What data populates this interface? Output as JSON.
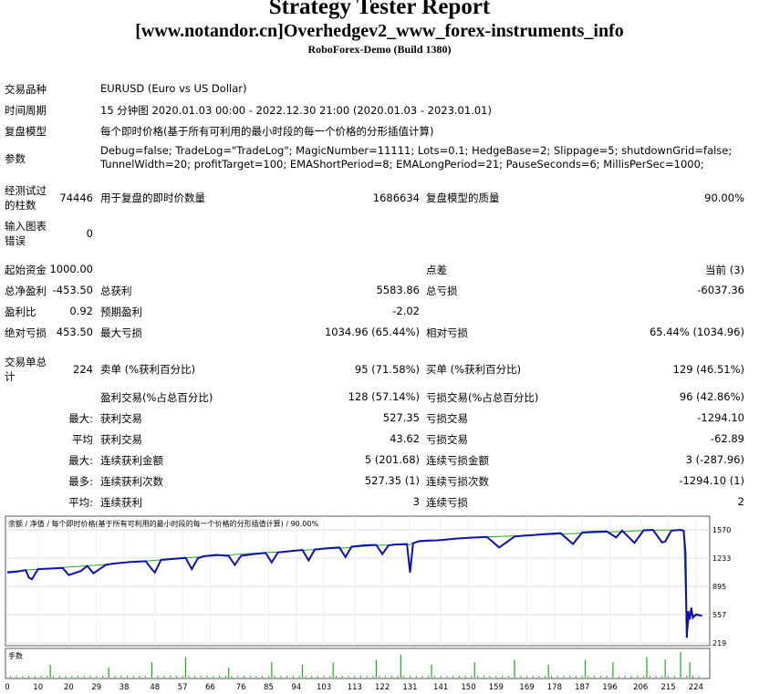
{
  "header": {
    "title": "Strategy Tester Report",
    "subtitle": "[www.notandor.cn]Overhedgev2_www_forex-instruments_info",
    "broker": "RoboForex-Demo (Build 1380)"
  },
  "info": {
    "symbol_label": "交易品种",
    "symbol_value": "EURUSD (Euro vs US Dollar)",
    "period_label": "时间周期",
    "period_value": "15 分钟图 2020.01.03 00:00 - 2022.12.30 21:00 (2020.01.03 - 2023.01.01)",
    "model_label": "复盘模型",
    "model_value": "每个即时价格(基于所有可利用的最小时段的每一个价格的分形插值计算)",
    "params_label": "参数",
    "params_line1": "Debug=false; TradeLog=\"TradeLog\"; MagicNumber=11111; Lots=0.1; HedgeBase=2; Slippage=5; shutdownGrid=false;",
    "params_line2": "TunnelWidth=20; profitTarget=100; EMAShortPeriod=8; EMALongPeriod=21; PauseSeconds=6; MillisPerSec=1000;"
  },
  "stats": {
    "bars_label1": "经测试过",
    "bars_label2": "的柱数",
    "bars_value": "74446",
    "ticks_label": "用于复盘的即时价数量",
    "ticks_value": "1686634",
    "quality_label": "复盘模型的质量",
    "quality_value": "90.00%",
    "errors_label1": "输入图表",
    "errors_label2": "错误",
    "errors_value": "0",
    "deposit_label": "起始资金",
    "deposit_value": "1000.00",
    "spread_label": "点差",
    "spread_value": "当前 (3)",
    "net_label": "总净盈利",
    "net_value": "-453.50",
    "gross_profit_label": "总获利",
    "gross_profit_value": "5583.86",
    "gross_loss_label": "总亏损",
    "gross_loss_value": "-6037.36",
    "pf_label": "盈利比",
    "pf_value": "0.92",
    "payoff_label": "预期盈利",
    "payoff_value": "-2.02",
    "abs_dd_label": "绝对亏损",
    "abs_dd_value": "453.50",
    "max_dd_label": "最大亏损",
    "max_dd_value": "1034.96 (65.44%)",
    "rel_dd_label": "相对亏损",
    "rel_dd_value": "65.44% (1034.96)",
    "trades_label1": "交易单总",
    "trades_label2": "计",
    "trades_value": "224",
    "short_label": "卖单 (%获利百分比)",
    "short_value": "95 (71.58%)",
    "long_label": "买单 (%获利百分比)",
    "long_value": "129 (46.51%)",
    "win_label": "盈利交易(%占总百分比)",
    "win_value": "128 (57.14%)",
    "loss_label": "亏损交易(%占总百分比)",
    "loss_value": "96 (42.86%)",
    "largest_label": "最大:",
    "largest_win_label": "获利交易",
    "largest_win_value": "527.35",
    "largest_loss_label": "亏损交易",
    "largest_loss_value": "-1294.10",
    "avg_label": "平均",
    "avg_win_label": "获利交易",
    "avg_win_value": "43.62",
    "avg_loss_label": "亏损交易",
    "avg_loss_value": "-62.89",
    "maxc_label": "最大:",
    "maxc_win_label": "连续获利金额",
    "maxc_win_value": "5 (201.68)",
    "maxc_loss_label": "连续亏损金额",
    "maxc_loss_value": "3 (-287.96)",
    "maxm_label": "最多:",
    "maxm_win_label": "连续获利次数",
    "maxm_win_value": "527.35 (1)",
    "maxm_loss_label": "连续亏损次数",
    "maxm_loss_value": "-1294.10 (1)",
    "avgc_label": "平均:",
    "avgc_win_label": "连续获利",
    "avgc_win_value": "3",
    "avgc_loss_label": "连续亏损",
    "avgc_loss_value": "2"
  },
  "chart_data": {
    "type": "line",
    "legend_text": "余额 / 净值 / 每个即时价格(基于所有可利用的最小时段的每一个价格的分形插值计算) / 90.00%",
    "legend_balance": "余额",
    "legend_equity": "净值",
    "yticks": [
      1570,
      1233,
      895,
      557,
      219
    ],
    "ylim": [
      219,
      1570
    ],
    "xticks": [
      0,
      10,
      20,
      29,
      38,
      48,
      57,
      66,
      76,
      85,
      94,
      103,
      113,
      122,
      131,
      141,
      150,
      159,
      169,
      178,
      187,
      196,
      206,
      215,
      224
    ],
    "xlim": [
      0,
      227
    ],
    "volume_label": "手数",
    "balance_color": "#1faa1f",
    "equity_color": "#1010aa",
    "series": [
      {
        "name": "余额",
        "x": [
          0,
          10,
          20,
          30,
          40,
          50,
          60,
          70,
          80,
          90,
          100,
          110,
          120,
          131,
          132,
          140,
          150,
          160,
          170,
          180,
          190,
          200,
          210,
          218,
          220,
          221,
          222,
          224,
          226
        ],
        "values": [
          1070,
          1100,
          1125,
          1150,
          1185,
          1210,
          1240,
          1265,
          1290,
          1310,
          1335,
          1355,
          1385,
          1395,
          1420,
          1445,
          1480,
          1490,
          1505,
          1520,
          1535,
          1550,
          1565,
          1570,
          1560,
          300,
          560,
          545,
          545
        ]
      },
      {
        "name": "净值",
        "x": [
          0,
          3,
          6,
          7,
          8,
          9,
          10,
          18,
          20,
          24,
          26,
          28,
          32,
          34,
          40,
          45,
          47,
          48,
          50,
          58,
          60,
          62,
          64,
          68,
          72,
          74,
          76,
          80,
          84,
          86,
          88,
          92,
          96,
          98,
          100,
          104,
          108,
          110,
          112,
          116,
          120,
          122,
          124,
          126,
          130,
          131,
          132,
          134,
          136,
          140,
          146,
          150,
          156,
          160,
          165,
          168,
          170,
          175,
          180,
          184,
          187,
          190,
          195,
          198,
          200,
          204,
          207,
          210,
          213,
          214,
          216,
          219,
          220,
          220.6,
          221,
          221.5,
          222,
          222.5,
          223,
          224,
          226
        ],
        "values": [
          1060,
          1070,
          1090,
          1000,
          980,
          1040,
          1100,
          1115,
          1030,
          1080,
          1140,
          1050,
          1150,
          1165,
          1185,
          1195,
          1100,
          1060,
          1210,
          1235,
          1100,
          1230,
          1255,
          1270,
          1260,
          1150,
          1260,
          1280,
          1295,
          1180,
          1300,
          1315,
          1330,
          1205,
          1335,
          1350,
          1360,
          1245,
          1370,
          1385,
          1390,
          1280,
          1385,
          1395,
          1400,
          1060,
          1410,
          1435,
          1440,
          1445,
          1465,
          1475,
          1485,
          1360,
          1490,
          1500,
          1505,
          1520,
          1530,
          1400,
          1540,
          1545,
          1550,
          1480,
          1560,
          1415,
          1565,
          1570,
          1420,
          1430,
          1560,
          1570,
          1560,
          1300,
          280,
          600,
          500,
          640,
          520,
          560,
          545
        ]
      }
    ],
    "volume_spikes": [
      {
        "x": 14,
        "v": 0.5
      },
      {
        "x": 33,
        "v": 0.4
      },
      {
        "x": 47,
        "v": 0.6
      },
      {
        "x": 58,
        "v": 0.8
      },
      {
        "x": 72,
        "v": 0.4
      },
      {
        "x": 86,
        "v": 0.6
      },
      {
        "x": 96,
        "v": 0.5
      },
      {
        "x": 106,
        "v": 0.6
      },
      {
        "x": 120,
        "v": 0.7
      },
      {
        "x": 128,
        "v": 0.9
      },
      {
        "x": 138,
        "v": 0.5
      },
      {
        "x": 152,
        "v": 0.6
      },
      {
        "x": 165,
        "v": 0.7
      },
      {
        "x": 176,
        "v": 0.5
      },
      {
        "x": 188,
        "v": 0.7
      },
      {
        "x": 197,
        "v": 0.6
      },
      {
        "x": 208,
        "v": 0.8
      },
      {
        "x": 214,
        "v": 0.7
      },
      {
        "x": 219,
        "v": 1.0
      },
      {
        "x": 222,
        "v": 0.6
      }
    ]
  }
}
